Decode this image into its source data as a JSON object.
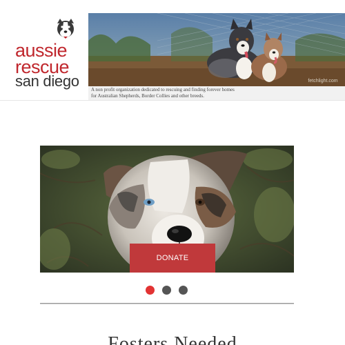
{
  "logo": {
    "line1": "aussie",
    "line2": "rescue",
    "line3": "san diego",
    "brand_color": "#c0272d"
  },
  "header": {
    "tagline_line1": "A non profit organization dedicated to rescuing and finding forever homes",
    "tagline_line2": "for Australian Shepherds, Border Collies and other breeds.",
    "banner_credit": "fetchlight.com"
  },
  "slider": {
    "donate_label": "DONATE",
    "slide_count": 3,
    "active_slide": 1,
    "accent_color": "#e23333"
  },
  "section": {
    "title": "Fosters Needed"
  }
}
